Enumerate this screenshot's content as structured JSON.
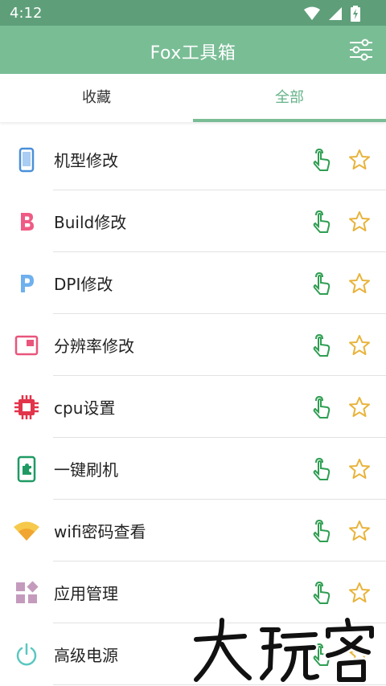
{
  "status_bar": {
    "time": "4:12"
  },
  "app_bar": {
    "title": "Fox工具箱"
  },
  "tabs": [
    {
      "label": "收藏",
      "selected": false
    },
    {
      "label": "全部",
      "selected": true
    }
  ],
  "colors": {
    "status_bar": "#5e9f79",
    "app_bar": "#79bd95",
    "tab_selected": "#66b389",
    "action_green": "#2f9e52",
    "star_yellow": "#e8b33a"
  },
  "tools": [
    {
      "label": "机型修改",
      "icon": "phone-icon"
    },
    {
      "label": "Build修改",
      "icon": "letter-b-icon"
    },
    {
      "label": "DPI修改",
      "icon": "letter-p-icon"
    },
    {
      "label": "分辨率修改",
      "icon": "screen-window-icon"
    },
    {
      "label": "cpu设置",
      "icon": "cpu-chip-icon"
    },
    {
      "label": "一键刷机",
      "icon": "phone-puzzle-icon"
    },
    {
      "label": "wifi密码查看",
      "icon": "wifi-icon"
    },
    {
      "label": "应用管理",
      "icon": "apps-grid-icon"
    },
    {
      "label": "高级电源",
      "icon": "power-icon"
    }
  ],
  "watermark": {
    "text": "大玩客"
  }
}
